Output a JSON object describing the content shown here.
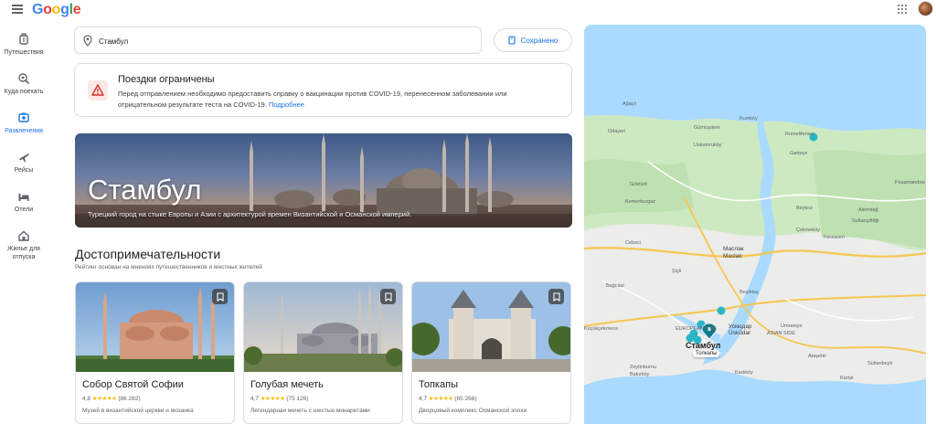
{
  "header": {
    "logo_letters": [
      "G",
      "o",
      "o",
      "g",
      "l",
      "e"
    ],
    "logo_colors": [
      "#4285f4",
      "#ea4335",
      "#fbbc05",
      "#4285f4",
      "#34a853",
      "#ea4335"
    ]
  },
  "rail": [
    {
      "label": "Путешествия",
      "icon": "luggage-icon"
    },
    {
      "label": "Куда поехать",
      "icon": "explore-icon"
    },
    {
      "label": "Развлечения",
      "icon": "attractions-icon",
      "active": true
    },
    {
      "label": "Рейсы",
      "icon": "flight-icon"
    },
    {
      "label": "Отели",
      "icon": "hotel-icon"
    },
    {
      "label": "Жилье для отпуска",
      "icon": "vacation-home-icon"
    }
  ],
  "search": {
    "value": "Стамбул"
  },
  "saved_button": {
    "label": "Сохранено"
  },
  "alert": {
    "title": "Поездки ограничены",
    "text": "Перед отправлением необходимо предоставить справку о вакцинации против COVID-19, перенесенном заболевании или отрицательном результате теста на COVID-19.",
    "link": "Подробнее"
  },
  "hero": {
    "city": "Стамбул",
    "description": "Турецкий город на стыке Европы и Азии с архитектурой времен Византийской и Османской империй."
  },
  "section": {
    "title": "Достопримечательности",
    "subtitle": "Рейтинг основан на мнениях путешественников и местных жителей"
  },
  "cards": [
    {
      "name": "Собор Святой Софии",
      "rating": "4,8",
      "stars": "★★★★★",
      "reviews": "(86 282)",
      "description": "Музей в византийской церкви и мозаика"
    },
    {
      "name": "Голубая мечеть",
      "rating": "4,7",
      "stars": "★★★★★",
      "reviews": "(75 126)",
      "description": "Легендарная мечеть с шестью минаретами"
    },
    {
      "name": "Топкапы",
      "rating": "4,7",
      "stars": "★★★★★",
      "reviews": "(65 266)",
      "description": "Дворцовый комплекс Османской эпохи"
    }
  ],
  "map": {
    "labels": {
      "agacli": "Ağaçlı",
      "gumusdere": "Gümüşdere",
      "kumkoy": "Kumköy",
      "rumelifeneri": "Rumelifeneri",
      "odayeri": "Odayeri",
      "kemerburgaz": "Kemerburgaz",
      "uskumrukoy": "Uskumruköy",
      "gokturk": "Göktürk",
      "garipce": "Garipçe",
      "cekmekoy": "Çekmeköy",
      "beykoz": "Beykoz",
      "maslak": "Maslak",
      "maslak_tr": "Маслак",
      "sisli": "Şişli",
      "besiktas": "Beşiktaş",
      "uskudar_ru": "Ускюдар",
      "uskudar": "Üsküdar",
      "istanbul": "Стамбул",
      "european_side": "EUROPEAN SIDE",
      "asian_side": "ASIAN SIDE",
      "zeytinburnu": "Zeytinburnu",
      "bakirkoy": "Bakırköy",
      "kadikoy": "Kadıköy",
      "atasehir": "Ataşehir",
      "umraniye": "Umraniye",
      "sultanbeyli": "Sultanbeyli",
      "pasamandira": "Pasamandıra",
      "kartal": "Kartal",
      "alemdag": "Alemdağ",
      "sultanciftligi": "Sultançiftliği",
      "kucukcekmece": "Küçükçekmece",
      "bagcilar": "Bağcılar",
      "cebeci": "Cebeci",
      "ferzaveri": "Ferzaveri",
      "tip": "Топкапы"
    }
  }
}
